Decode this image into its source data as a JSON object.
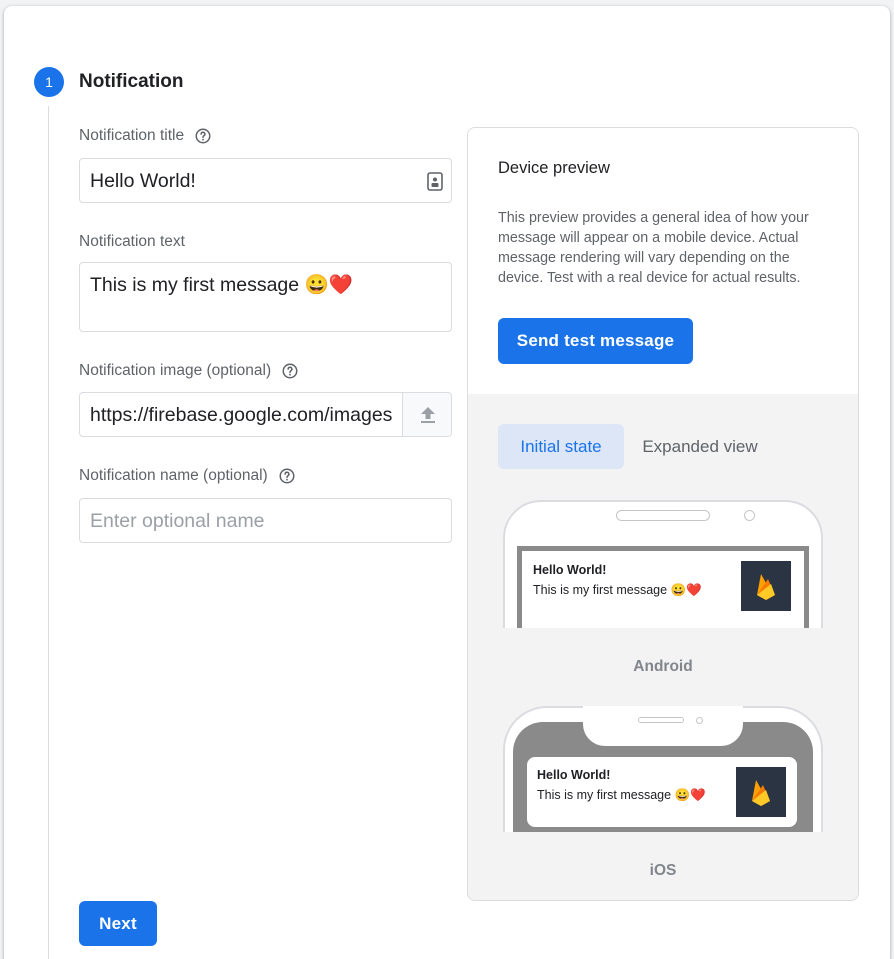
{
  "step": {
    "number": "1",
    "title": "Notification"
  },
  "fields": {
    "title": {
      "label": "Notification title",
      "value": "Hello World!"
    },
    "text": {
      "label": "Notification text",
      "value": "This is my first message 😀❤️"
    },
    "image": {
      "label": "Notification image (optional)",
      "value": "https://firebase.google.com/images"
    },
    "name": {
      "label": "Notification name (optional)",
      "placeholder": "Enter optional name"
    }
  },
  "next_button": "Next",
  "preview": {
    "title": "Device preview",
    "description": "This preview provides a general idea of how your message will appear on a mobile device. Actual message rendering will vary depending on the device. Test with a real device for actual results.",
    "send_button": "Send test message",
    "tabs": {
      "initial": "Initial state",
      "expanded": "Expanded view"
    },
    "android": {
      "label": "Android",
      "notif_title": "Hello World!",
      "notif_text": "This is my first message 😀❤️"
    },
    "ios": {
      "label": "iOS",
      "notif_title": "Hello World!",
      "notif_text": "This is my first message 😀❤️"
    }
  },
  "colors": {
    "accent": "#1a73e8",
    "tab_active_bg": "#dce6f7",
    "thumb_bg": "#2b3442"
  }
}
